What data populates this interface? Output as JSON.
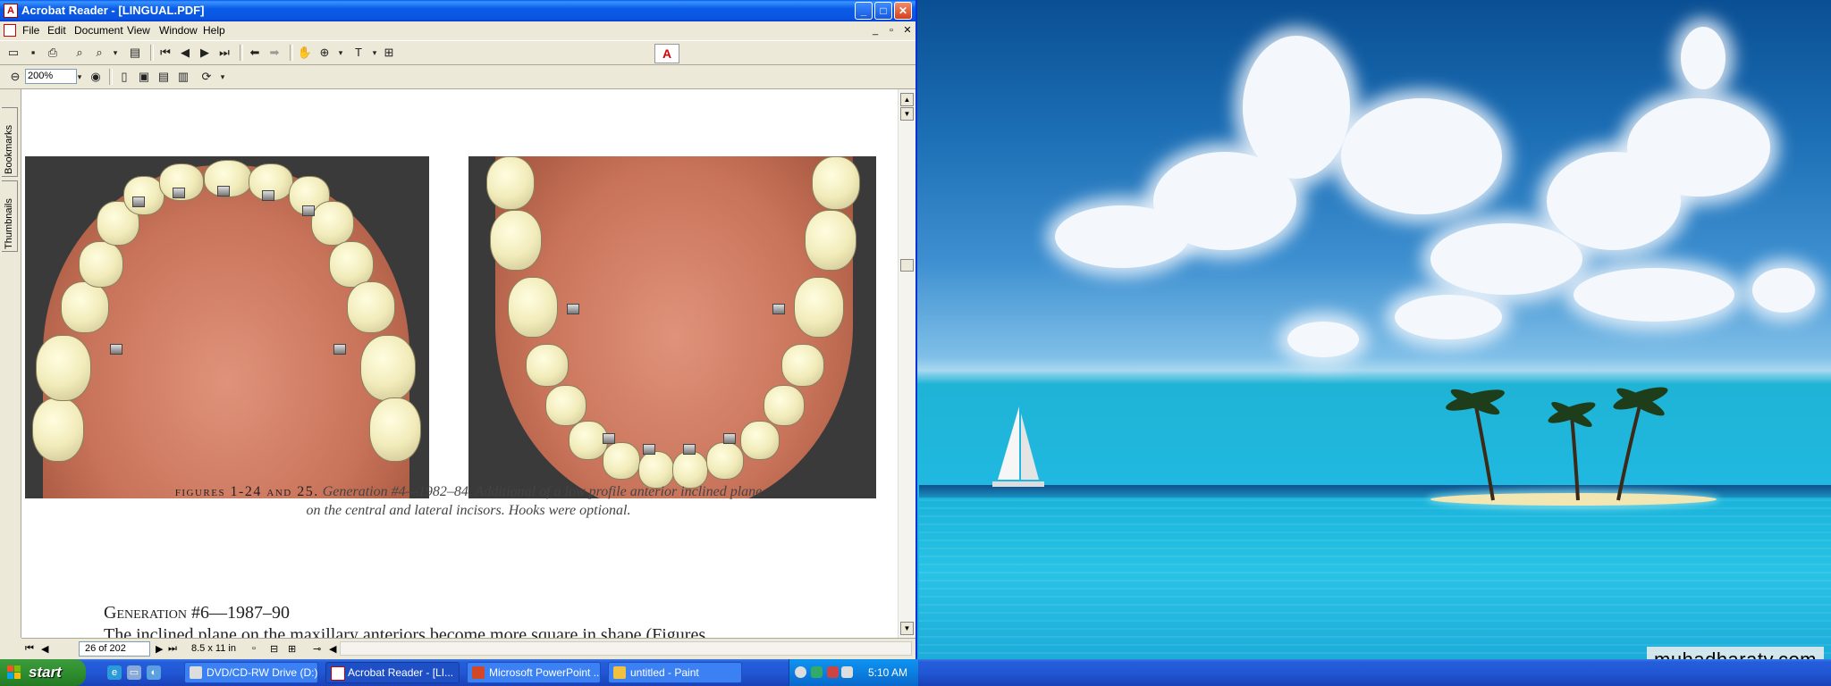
{
  "window": {
    "title": "Acrobat Reader - [LINGUAL.PDF]",
    "controls": {
      "minimize": "_",
      "maximize": "□",
      "close": "✕"
    }
  },
  "menubar": {
    "items": [
      "File",
      "Edit",
      "Document",
      "View",
      "Window",
      "Help"
    ],
    "mdi_controls": [
      "_",
      "▫",
      "✕"
    ]
  },
  "toolbar": {
    "zoom_value": "200%",
    "adobe_logo": "A",
    "tools": [
      "open-icon",
      "save-icon",
      "print-icon",
      "find-icon",
      "search-icon",
      "show-hide-navigation-icon",
      "first-page-icon",
      "previous-page-icon",
      "next-page-icon",
      "last-page-icon",
      "go-back-icon",
      "go-forward-icon",
      "hand-tool-icon",
      "zoom-tool-icon",
      "text-select-icon",
      "column-select-icon",
      "zoom-out-icon",
      "zoom-in-circle-icon",
      "actual-size-icon",
      "fit-page-icon",
      "fit-width-icon",
      "rotate-icon"
    ]
  },
  "nav_tabs": [
    "Bookmarks",
    "Thumbnails"
  ],
  "document": {
    "caption_label": "figures 1-24 and 25.",
    "caption_text": "Generation #4—1982–84. Additional of a low profile anterior inclined plane",
    "caption_text2": "on the central and lateral incisors. Hooks were optional.",
    "section_heading": "Generation #6—1987–90",
    "body_text_partial": "The inclined plane on the maxillary anteriors become more square in shape (Figures"
  },
  "statusbar": {
    "page_indicator": "26 of 202",
    "page_size": "8.5 x 11 in"
  },
  "taskbar": {
    "start_label": "start",
    "tasks": [
      {
        "label": "DVD/CD-RW Drive (D:)",
        "active": false
      },
      {
        "label": "Acrobat Reader - [LI...",
        "active": true
      },
      {
        "label": "Microsoft PowerPoint ...",
        "active": false
      },
      {
        "label": "untitled - Paint",
        "active": false
      }
    ],
    "clock": "5:10 AM"
  },
  "watermark": "muhadharaty.com",
  "colors": {
    "titlebar": "#0a5ce8",
    "taskbar": "#245edb",
    "start_button": "#2f8f2f",
    "window_face": "#ece9d8"
  }
}
